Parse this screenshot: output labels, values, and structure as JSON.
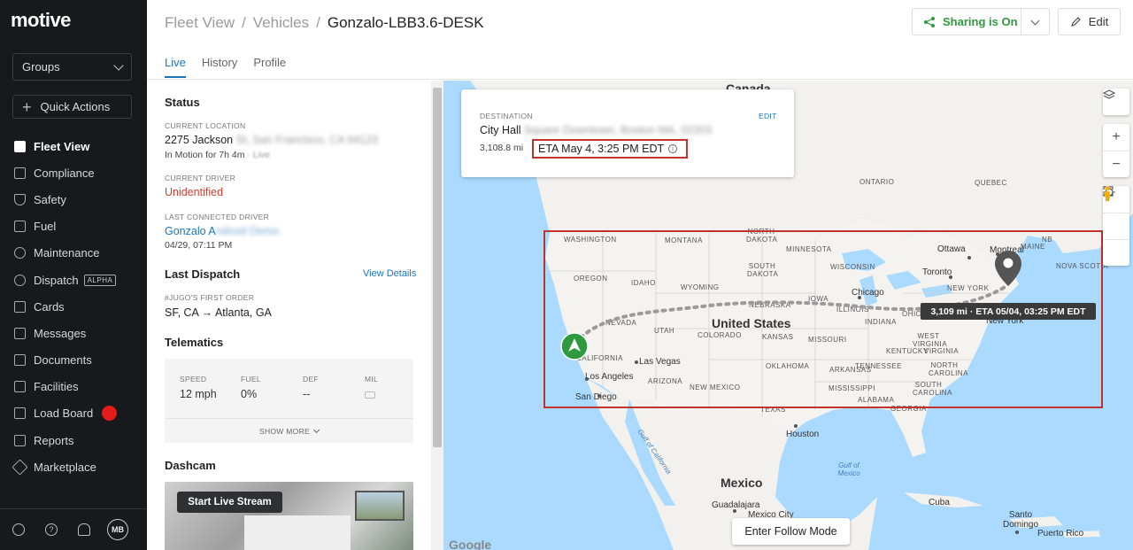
{
  "app": {
    "logo": "motive"
  },
  "sidebar": {
    "groups_label": "Groups",
    "quick_actions_label": "Quick Actions",
    "items": [
      {
        "label": "Fleet View",
        "icon": "map-icon",
        "active": true
      },
      {
        "label": "Compliance",
        "icon": "document-icon"
      },
      {
        "label": "Safety",
        "icon": "shield-icon"
      },
      {
        "label": "Fuel",
        "icon": "fuel-icon"
      },
      {
        "label": "Maintenance",
        "icon": "wrench-icon"
      },
      {
        "label": "Dispatch",
        "icon": "dispatch-icon",
        "badge": "ALPHA"
      },
      {
        "label": "Cards",
        "icon": "card-icon"
      },
      {
        "label": "Messages",
        "icon": "message-icon"
      },
      {
        "label": "Documents",
        "icon": "documents-icon"
      },
      {
        "label": "Facilities",
        "icon": "building-icon"
      },
      {
        "label": "Load Board",
        "icon": "load-board-icon"
      },
      {
        "label": "Reports",
        "icon": "reports-icon"
      },
      {
        "label": "Marketplace",
        "icon": "marketplace-icon"
      }
    ],
    "footer": {
      "avatar": "MB"
    }
  },
  "header": {
    "breadcrumb": [
      "Fleet View",
      "Vehicles",
      "Gonzalo-LBB3.6-DESK"
    ],
    "separator": "/",
    "tabs": [
      "Live",
      "History",
      "Profile"
    ],
    "sharing_label": "Sharing is On",
    "edit_label": "Edit"
  },
  "status": {
    "title": "Status",
    "current_location_label": "CURRENT LOCATION",
    "current_location": "2275 Jackson",
    "current_location_blurred": "St, San Francisco, CA 94123",
    "motion": "In Motion for 7h 4m",
    "motion_extra": "· Live",
    "current_driver_label": "CURRENT DRIVER",
    "current_driver": "Unidentified",
    "last_driver_label": "LAST CONNECTED DRIVER",
    "last_driver": "Gonzalo A",
    "last_driver_blurred": "ndroid Demo",
    "last_driver_time": "04/29, 07:11 PM"
  },
  "dispatch": {
    "title": "Last Dispatch",
    "view_details": "View Details",
    "order_label": "#JUGO'S FIRST ORDER",
    "route": "SF, CA → Atlanta, GA"
  },
  "telematics": {
    "title": "Telematics",
    "cols": [
      {
        "label": "SPEED",
        "value": "12 mph"
      },
      {
        "label": "FUEL",
        "value": "0%"
      },
      {
        "label": "DEF",
        "value": "--"
      },
      {
        "label": "MIL",
        "value": ""
      }
    ],
    "show_more": "SHOW MORE"
  },
  "dashcam": {
    "title": "Dashcam",
    "live_stream_label": "Start Live Stream"
  },
  "map": {
    "destination_label": "DESTINATION",
    "destination_edit": "EDIT",
    "destination": "City Hall",
    "destination_blurred": "Square Downtown, Boston MA, 02203",
    "distance": "3,108.8 mi",
    "eta": "ETA May 4, 3:25 PM EDT",
    "eta_tooltip": "3,109 mi  ·  ETA 05/04, 03:25 PM EDT",
    "follow_mode": "Enter Follow Mode",
    "attribution": "Google",
    "labels": {
      "canada": "Canada",
      "us": "United States",
      "mexico": "Mexico",
      "washington": "WASHINGTON",
      "montana": "MONTANA",
      "north_dakota": "NORTH DAKOTA",
      "minnesota": "MINNESOTA",
      "south_dakota": "SOUTH DAKOTA",
      "wisconsin": "WISCONSIN",
      "oregon": "OREGON",
      "idaho": "IDAHO",
      "wyoming": "WYOMING",
      "iowa": "IOWA",
      "nebraska": "NEBRASKA",
      "illinois": "ILLINOIS",
      "nevada": "NEVADA",
      "utah": "UTAH",
      "colorado": "COLORADO",
      "kansas": "KANSAS",
      "missouri": "MISSOURI",
      "indiana": "INDIANA",
      "ohio": "OHIO",
      "california": "CALIFORNIA",
      "arizona": "ARIZONA",
      "new_mexico": "NEW MEXICO",
      "oklahoma": "OKLAHOMA",
      "texas": "TEXAS",
      "arkansas": "ARKANSAS",
      "tennessee": "TENNESSEE",
      "kentucky": "KENTUCKY",
      "mississippi": "MISSISSIPPI",
      "alabama": "ALABAMA",
      "georgia": "GEORGIA",
      "west_virginia": "WEST VIRGINIA",
      "virginia": "VIRGINIA",
      "north_carolina": "NORTH CAROLINA",
      "south_carolina": "SOUTH CAROLINA",
      "new_york": "NEW YORK",
      "new_york_city": "New York",
      "ontario": "ONTARIO",
      "quebec": "QUEBEC",
      "nb": "NB",
      "nova_scotia": "NOVA SCOTIA",
      "maine": "MAINE",
      "ottawa": "Ottawa",
      "montreal": "Montreal",
      "toronto": "Toronto",
      "chicago": "Chicago",
      "las_vegas": "Las Vegas",
      "los_angeles": "Los Angeles",
      "san_diego": "San Diego",
      "houston": "Houston",
      "guadalajara": "Guadalajara",
      "mexico_city": "Mexico City",
      "cuba": "Cuba",
      "santo_domingo": "Santo Domingo",
      "puerto_rico": "Puerto Rico",
      "gulf_california": "Gulf of California",
      "gulf_mexico": "Gulf of Mexico"
    }
  },
  "colors": {
    "accent": "#1c75bc",
    "sharing": "#2e9a3e",
    "highlight": "#c0342b",
    "alert": "#e31b1b"
  }
}
